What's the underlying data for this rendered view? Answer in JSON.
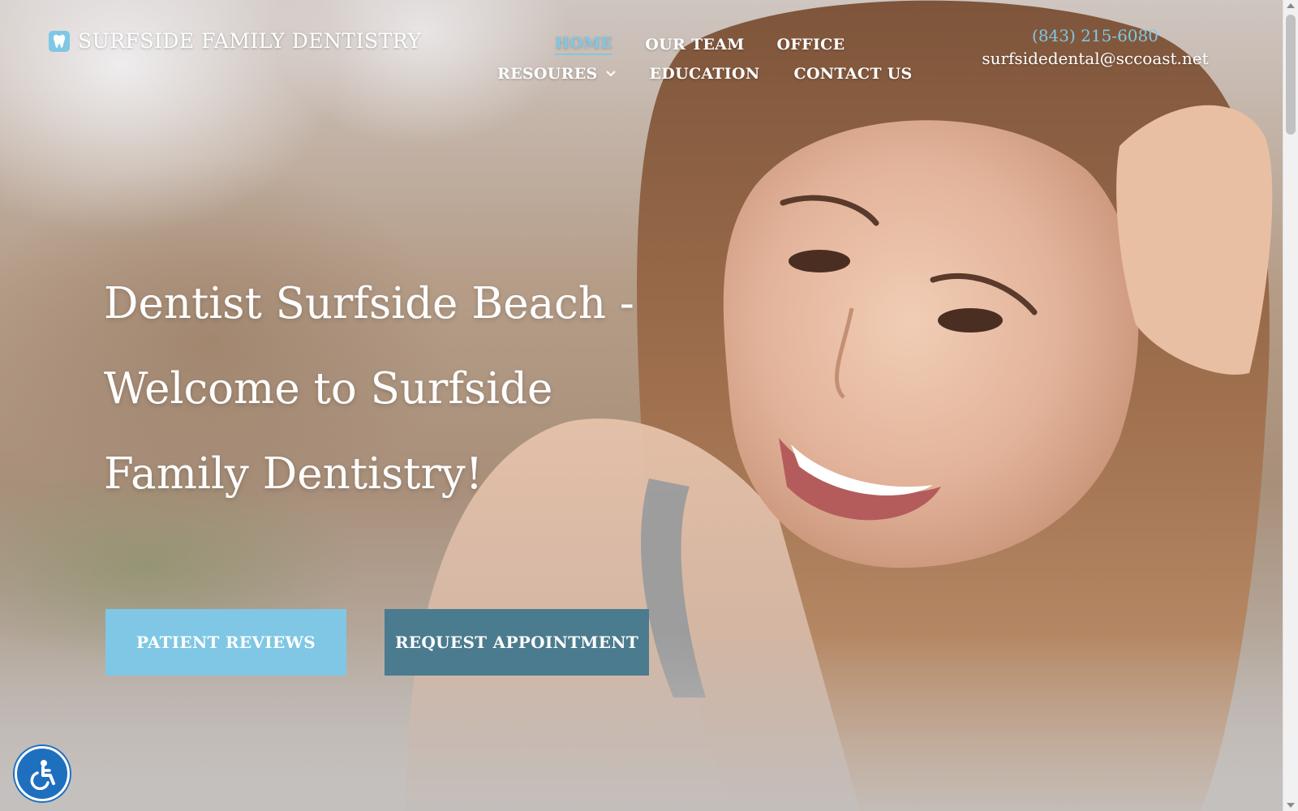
{
  "site": {
    "logo_text": "SURFSIDE FAMILY DENTISTRY",
    "logo_icon": "tooth-icon"
  },
  "nav": {
    "row1": [
      {
        "label": "HOME",
        "active": true
      },
      {
        "label": "OUR TEAM",
        "active": false
      },
      {
        "label": "OFFICE",
        "active": false
      }
    ],
    "row2": [
      {
        "label": "RESOURES",
        "has_dropdown": true
      },
      {
        "label": "EDUCATION",
        "has_dropdown": false
      },
      {
        "label": "CONTACT US",
        "has_dropdown": false
      }
    ]
  },
  "contact": {
    "phone": "(843) 215-6080",
    "email": "surfsidedental@sccoast.net"
  },
  "hero": {
    "headline": "Dentist Surfside Beach - Welcome to Surfside Family Dentistry!",
    "buttons": {
      "reviews": "PATIENT REVIEWS",
      "request": "REQUEST APPOINTMENT"
    }
  },
  "accessibility": {
    "icon": "accessibility-icon"
  },
  "colors": {
    "accent_light": "#7fc7e4",
    "accent_dark": "#4b7b8e",
    "accessibility_blue": "#1f6fbf",
    "text": "#ffffff"
  }
}
